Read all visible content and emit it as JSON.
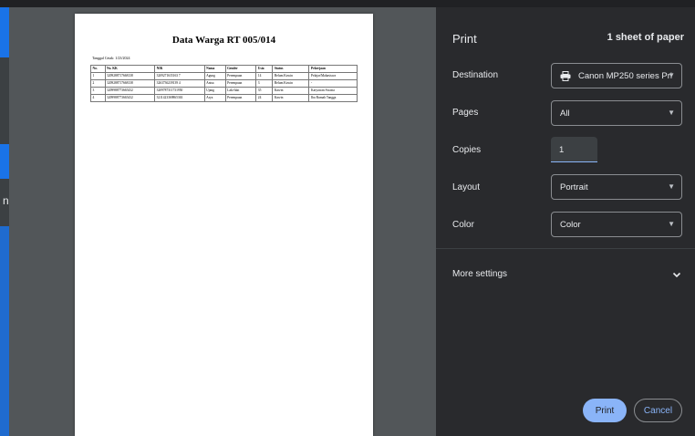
{
  "preview": {
    "title": "Data Warga RT 005/014",
    "date": "Tanggal Cetak: 1/23/2024",
    "columns": [
      "No.",
      "No. KK",
      "NIK",
      "Nama",
      "Gender",
      "Usia",
      "Status",
      "Pekerjaan"
    ],
    "rows": [
      [
        "1",
        "3209288717668138",
        "3209271635163 7",
        "Agung",
        "Perempuan",
        "14",
        "Belum Kawin",
        "Pelajar/Mahasiswa"
      ],
      [
        "2",
        "3209288717668138",
        "3263736239139 4",
        "Anisa",
        "Perempuan",
        "3",
        "Belum Kawin",
        "-"
      ],
      [
        "3",
        "3209988773665432",
        "3209787311731950",
        "Ujang",
        "Laki-laki",
        "35",
        "Kawin",
        "Karyawan Swasta"
      ],
      [
        "4",
        "3209988773665432",
        "3211423369865363",
        "Arya",
        "Perempuan",
        "24",
        "Kawin",
        "Ibu Rumah Tangga"
      ]
    ]
  },
  "panel": {
    "title": "Print",
    "sheets": "1 sheet of paper",
    "destination_label": "Destination",
    "destination_value": "Canon MP250 series Pri",
    "pages_label": "Pages",
    "pages_value": "All",
    "copies_label": "Copies",
    "copies_value": "1",
    "layout_label": "Layout",
    "layout_value": "Portrait",
    "color_label": "Color",
    "color_value": "Color",
    "more_settings": "More settings",
    "print_button": "Print",
    "cancel_button": "Cancel"
  }
}
